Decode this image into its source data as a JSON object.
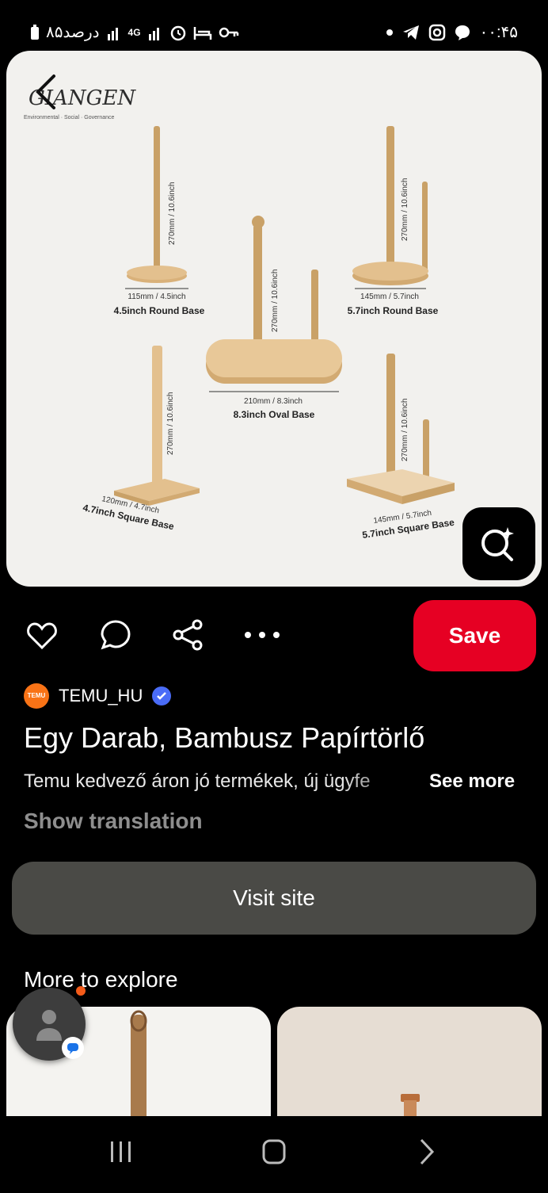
{
  "status_bar": {
    "left_text": "۸۵درصد",
    "network": "4G",
    "time": "۰۰:۴۵"
  },
  "pin_image": {
    "brand": "GIANGEN",
    "brand_tagline": "Environmental · Social · Governance",
    "products": [
      {
        "dim": "115mm / 4.5inch",
        "name": "4.5inch Round Base",
        "height": "270mm / 10.6inch"
      },
      {
        "dim": "145mm / 5.7inch",
        "name": "5.7inch Round Base",
        "height": "270mm / 10.6inch"
      },
      {
        "dim": "210mm / 8.3inch",
        "name": "8.3inch Oval Base",
        "height": "270mm / 10.6inch"
      },
      {
        "dim": "120mm / 4.7inch",
        "name": "4.7inch Square Base",
        "height": "270mm / 10.6inch"
      },
      {
        "dim": "145mm / 5.7inch",
        "name": "5.7inch Square Base",
        "height": "270mm / 10.6inch"
      }
    ]
  },
  "actions": {
    "save_label": "Save"
  },
  "creator": {
    "avatar_text": "TEMU",
    "name": "TEMU_HU"
  },
  "pin": {
    "title": "Egy Darab, Bambusz Papírtörlő",
    "description": "Temu kedvező áron jó termékek, új ügyfe",
    "see_more": "See more",
    "show_translation": "Show translation",
    "visit_site": "Visit site"
  },
  "explore": {
    "heading": "More to explore"
  },
  "icons": {
    "heart": "heart-icon",
    "comment": "comment-icon",
    "share": "share-icon",
    "more": "more-icon",
    "lens": "visual-search-icon",
    "back": "back-icon"
  }
}
